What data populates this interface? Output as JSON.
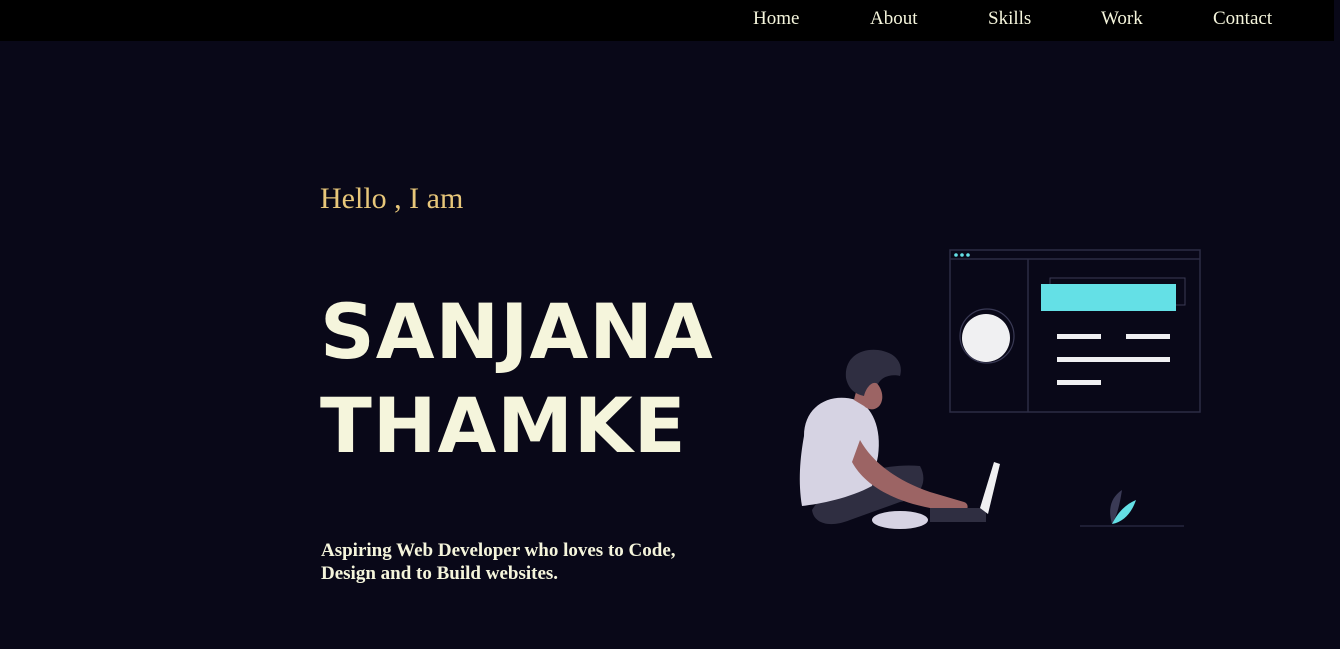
{
  "nav": {
    "links": [
      {
        "label": "Home"
      },
      {
        "label": "About"
      },
      {
        "label": "Skills"
      },
      {
        "label": "Work"
      },
      {
        "label": "Contact"
      }
    ]
  },
  "hero": {
    "greeting": "Hello , I am",
    "name_first": "SANJANA",
    "name_last": "THAMKE",
    "tagline": "Aspiring Web Developer who loves to Code, Design and to Build websites.",
    "illustration_icon": "developer-with-laptop-illustration"
  },
  "colors": {
    "background": "#090818",
    "navbar": "#000000",
    "text": "#f5f5dc",
    "greeting": "#e8c77a",
    "accent": "#64e0e6"
  }
}
